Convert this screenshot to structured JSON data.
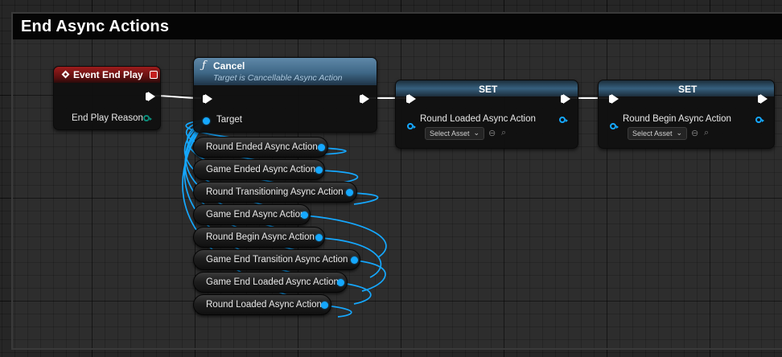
{
  "comment": {
    "title": "End Async Actions"
  },
  "event_node": {
    "title": "Event End Play",
    "output_label": "End Play Reason"
  },
  "cancel_node": {
    "title": "Cancel",
    "subtitle": "Target is Cancellable Async Action",
    "input_label": "Target"
  },
  "set_nodes": [
    {
      "title": "SET",
      "variable": "Round Loaded Async Action",
      "picker_label": "Select Asset"
    },
    {
      "title": "SET",
      "variable": "Round Begin Async Action",
      "picker_label": "Select Asset"
    }
  ],
  "variable_getters": [
    "Round Ended Async Action",
    "Game Ended Async Action",
    "Round Transitioning Async Action",
    "Game End Async Action",
    "Round Begin Async Action",
    "Game End Transition Async Action",
    "Game End Loaded Async Action",
    "Round Loaded Async Action"
  ],
  "colors": {
    "exec_wire": "#ffffff",
    "object_wire": "#15a8ff",
    "event_header": "#9d1c1c",
    "function_header": "#5f88a8",
    "enum_pin": "#0b8c7a"
  },
  "icons": {
    "event": "event-diamond-icon",
    "stop": "stop-icon",
    "function": "function-icon",
    "browse": "browse-arrow-icon",
    "search": "search-icon",
    "dropdown": "chevron-down-icon"
  }
}
